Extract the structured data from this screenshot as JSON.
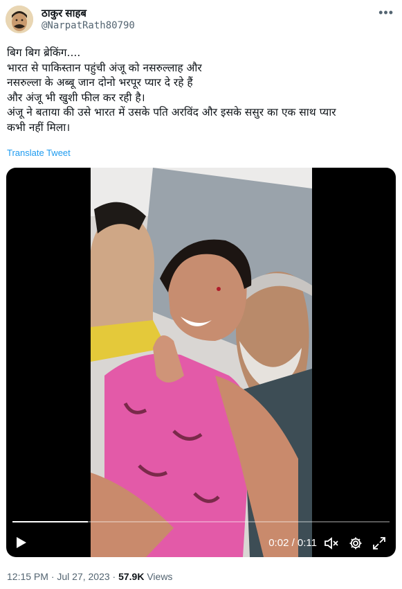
{
  "author": {
    "name": "ठाकुर साहब",
    "handle": "@NarpatRath80790"
  },
  "tweet": {
    "lines": [
      "बिग बिग ब्रेकिंग....",
      "भारत से पाकिस्तान पहुंची अंजू को नसरुल्लाह और",
      "नसरुल्ला के अब्बू जान दोनो भरपूर प्यार दे रहे हैं",
      "और अंजू भी खुशी फील कर रही है।",
      "अंजू ने बताया की उसे भारत में उसके पति अरविंद और इसके ससुर का एक साथ प्यार",
      "कभी नहीं मिला।"
    ],
    "translate_label": "Translate Tweet"
  },
  "video": {
    "elapsed_time": "0:02 / 0:11",
    "progress": 0.2
  },
  "meta": {
    "time": "12:15 PM · Jul 27, 2023 · ",
    "views_count": "57.9K",
    "views_label": " Views"
  },
  "icons": [
    "more-icon",
    "play-icon",
    "mute-icon",
    "settings-icon",
    "fullscreen-icon"
  ],
  "colors": {
    "link": "#1d9bf0",
    "secondary": "#536471",
    "text": "#0f1419"
  }
}
